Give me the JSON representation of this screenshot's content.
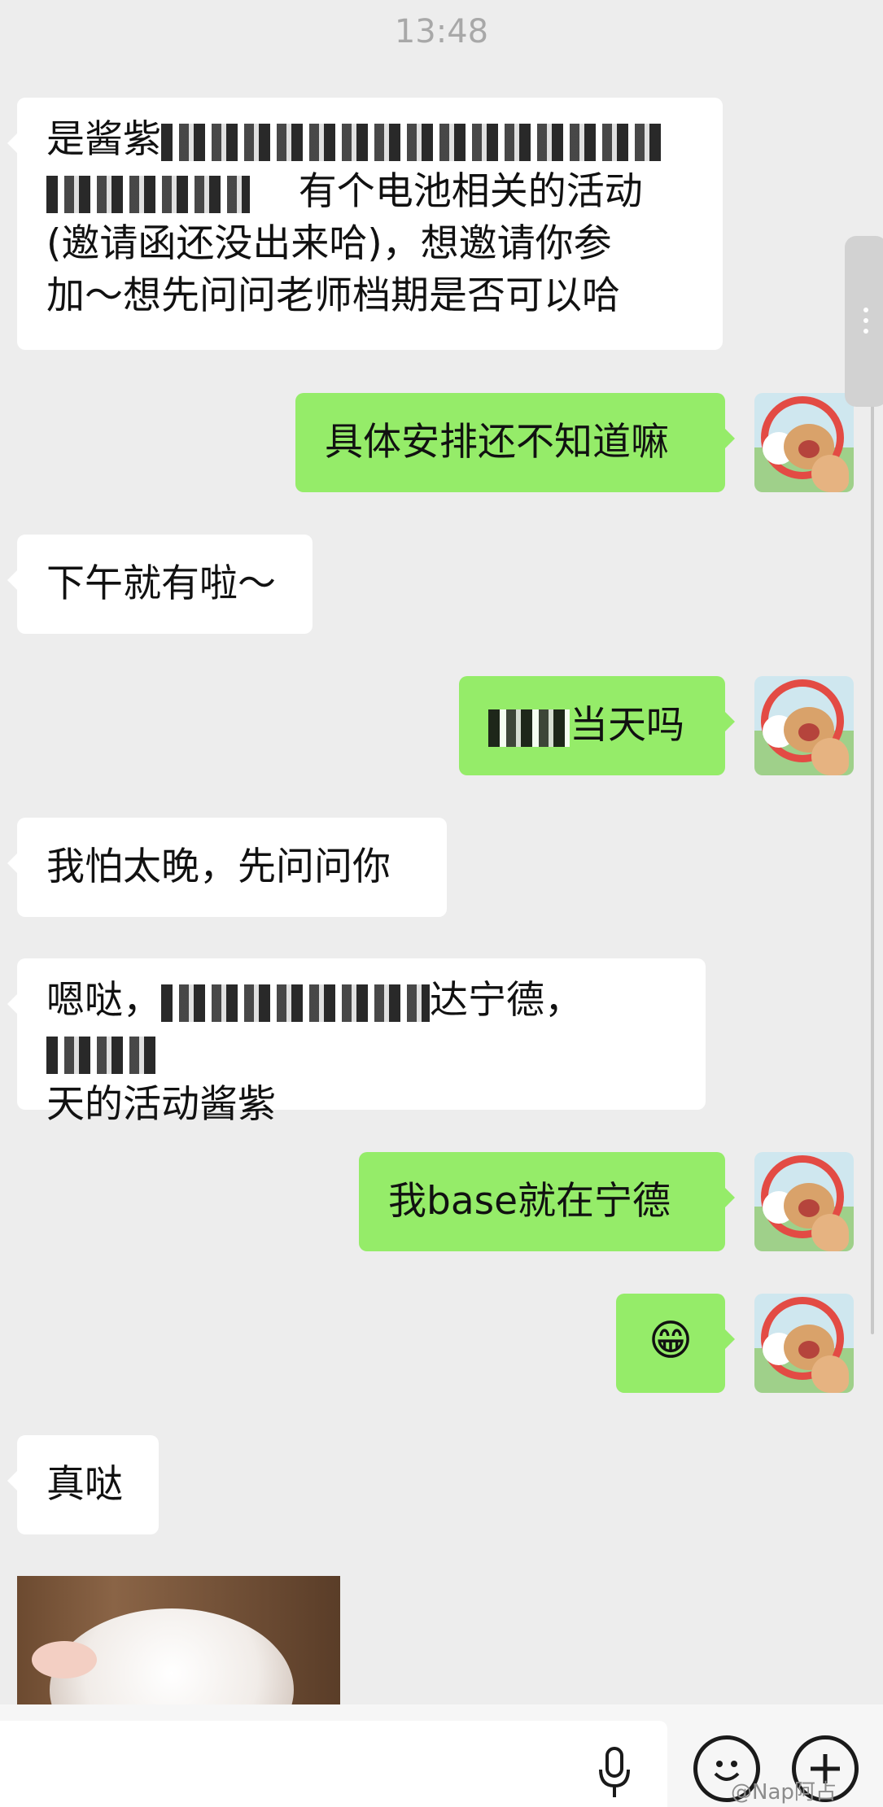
{
  "status_bar": {
    "time": "13:48"
  },
  "messages": [
    {
      "id": "m1",
      "side": "in",
      "segments": [
        "是酱紫",
        "",
        "\n",
        "",
        "有个电池相关的活动\n",
        "(邀请函还没出来哈)，想邀请你参\n加～想先问问老师档期是否可以哈"
      ]
    },
    {
      "id": "m2",
      "side": "out",
      "text": "具体安排还不知道嘛"
    },
    {
      "id": "m3",
      "side": "in",
      "text": "下午就有啦～"
    },
    {
      "id": "m4",
      "side": "out",
      "segments": [
        "",
        "当天吗"
      ]
    },
    {
      "id": "m5",
      "side": "in",
      "text": "我怕太晚，先问问你"
    },
    {
      "id": "m6",
      "side": "in",
      "segments": [
        "嗯哒，",
        "",
        "达宁德，",
        "",
        "\n天的活动酱紫"
      ]
    },
    {
      "id": "m7",
      "side": "out",
      "text": "我base就在宁德"
    },
    {
      "id": "m8",
      "side": "out",
      "emoji": "😁"
    },
    {
      "id": "m9",
      "side": "in",
      "text": "真哒"
    }
  ],
  "input_bar": {
    "voice_icon": "mic-icon",
    "emoji_icon": "smiley-icon",
    "more_icon": "plus-icon"
  },
  "watermark": "@Nap阿占",
  "colors": {
    "bubble_out": "#95ec69",
    "bubble_in": "#ffffff",
    "background": "#ededed"
  }
}
